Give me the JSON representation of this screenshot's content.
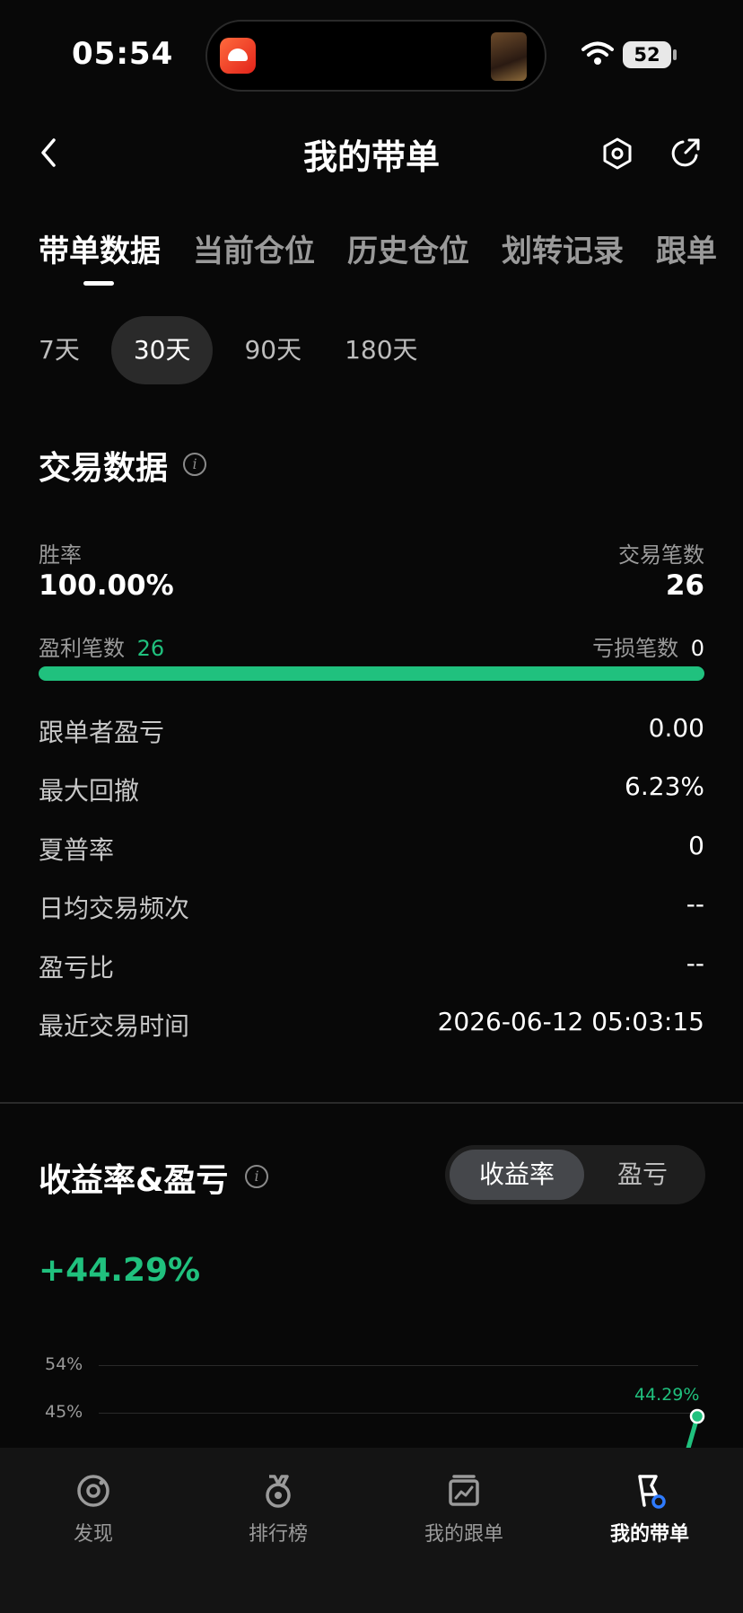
{
  "status_bar": {
    "time": "05:54",
    "battery": "52"
  },
  "header": {
    "title": "我的带单"
  },
  "tabs": [
    {
      "label": "带单数据",
      "active": true
    },
    {
      "label": "当前仓位"
    },
    {
      "label": "历史仓位"
    },
    {
      "label": "划转记录"
    },
    {
      "label": "跟单"
    }
  ],
  "periods": [
    {
      "label": "7天"
    },
    {
      "label": "30天",
      "active": true
    },
    {
      "label": "90天"
    },
    {
      "label": "180天"
    }
  ],
  "trade_data": {
    "title": "交易数据",
    "win_rate_label": "胜率",
    "win_rate": "100.00%",
    "trade_count_label": "交易笔数",
    "trade_count": "26",
    "profit_count_label": "盈利笔数",
    "profit_count": "26",
    "loss_count_label": "亏损笔数",
    "loss_count": "0",
    "win_fraction": 1.0,
    "rows": [
      {
        "label": "跟单者盈亏",
        "value": "0.00"
      },
      {
        "label": "最大回撤",
        "value": "6.23%"
      },
      {
        "label": "夏普率",
        "value": "0"
      },
      {
        "label": "日均交易频次",
        "value": "--"
      },
      {
        "label": "盈亏比",
        "value": "--"
      },
      {
        "label": "最近交易时间",
        "value": "2026-06-12 05:03:15"
      }
    ]
  },
  "returns": {
    "title": "收益率&盈亏",
    "toggle_active": "收益率",
    "toggle_other": "盈亏",
    "value": "+44.29%"
  },
  "chart_data": {
    "type": "line",
    "y_ticks": [
      "54%",
      "45%"
    ],
    "last_point_label": "44.29%",
    "last_value": 44.29
  },
  "colors": {
    "accent_green": "#20c17e",
    "background": "#080808"
  },
  "bottom_nav": [
    {
      "label": "发现",
      "icon": "discover-icon"
    },
    {
      "label": "排行榜",
      "icon": "medal-icon"
    },
    {
      "label": "我的跟单",
      "icon": "chart-card-icon"
    },
    {
      "label": "我的带单",
      "icon": "flag-icon",
      "active": true
    }
  ]
}
